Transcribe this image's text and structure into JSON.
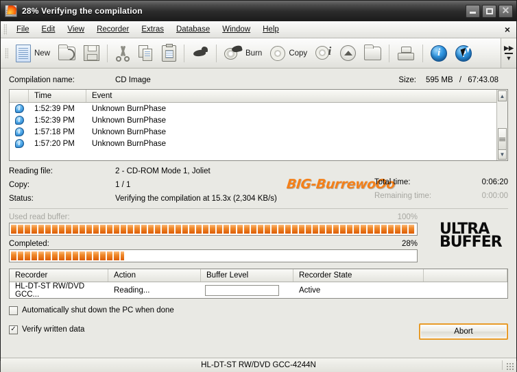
{
  "window": {
    "title": "28% Verifying the compilation",
    "app_icon": "nero-burn-icon",
    "minimize": "minimize-icon",
    "maximize": "maximize-icon",
    "close": "close-icon"
  },
  "menu": {
    "items": [
      "File",
      "Edit",
      "View",
      "Recorder",
      "Extras",
      "Database",
      "Window",
      "Help"
    ],
    "close_label": "×"
  },
  "toolbar": {
    "new_label": "New",
    "burn_label": "Burn",
    "copy_label": "Copy",
    "icons": [
      "new-document-icon",
      "open-folder-icon",
      "save-icon",
      "cut-scissors-icon",
      "copy-icon",
      "paste-icon",
      "bird-icon",
      "burn-disc-icon",
      "copy-disc-icon",
      "disc-info-icon",
      "eject-icon",
      "folder-icon",
      "scanner-icon",
      "info-icon",
      "help-icon"
    ],
    "overflow": "toolbar-overflow-icon"
  },
  "compilation": {
    "name_label": "Compilation name:",
    "name_value": "CD Image",
    "size_label": "Size:",
    "size_value": "595 MB",
    "size_separator": "/",
    "size_time": "67:43.08"
  },
  "log": {
    "columns": [
      "",
      "Time",
      "Event"
    ],
    "rows": [
      {
        "icon": "info-balloon-icon",
        "time": "1:52:39 PM",
        "event": "Unknown BurnPhase"
      },
      {
        "icon": "info-balloon-icon",
        "time": "1:52:39 PM",
        "event": "Unknown BurnPhase"
      },
      {
        "icon": "info-balloon-icon",
        "time": "1:57:18 PM",
        "event": "Unknown BurnPhase"
      },
      {
        "icon": "info-balloon-icon",
        "time": "1:57:20 PM",
        "event": "Unknown BurnPhase"
      }
    ]
  },
  "status": {
    "reading_file_label": "Reading file:",
    "reading_file_value": "2 - CD-ROM Mode 1, Joliet",
    "copy_label": "Copy:",
    "copy_value": "1 / 1",
    "status_label": "Status:",
    "status_value": "Verifying the compilation at 15.3x (2,304 KB/s)",
    "total_time_label": "Total time:",
    "total_time_value": "0:06:20",
    "remaining_time_label": "Remaining time:",
    "remaining_time_value": "0:00:00"
  },
  "watermark": {
    "text": "BIG-BurrewoOo",
    "color": "#f3801a"
  },
  "progress": {
    "buffer_label": "Used read buffer:",
    "buffer_percent": "100%",
    "buffer_fill": 100,
    "completed_label": "Completed:",
    "completed_percent": "28%",
    "completed_fill": 28,
    "fill_color": "#e8751a"
  },
  "ultra_buffer": {
    "line1": "ULTRA",
    "line2": "BUFFER"
  },
  "recorder_table": {
    "columns": [
      "Recorder",
      "Action",
      "Buffer Level",
      "Recorder State",
      ""
    ],
    "rows": [
      {
        "recorder": "HL-DT-ST RW/DVD GCC...",
        "action": "Reading...",
        "buffer_level": "",
        "state": "Active"
      }
    ]
  },
  "options": {
    "shutdown_label": "Automatically shut down the PC when done",
    "shutdown_checked": false,
    "verify_label": "Verify written data",
    "verify_checked": true,
    "check_glyph": "✓"
  },
  "buttons": {
    "abort_label": "Abort"
  },
  "statusbar": {
    "text": "HL-DT-ST RW/DVD GCC-4244N"
  }
}
